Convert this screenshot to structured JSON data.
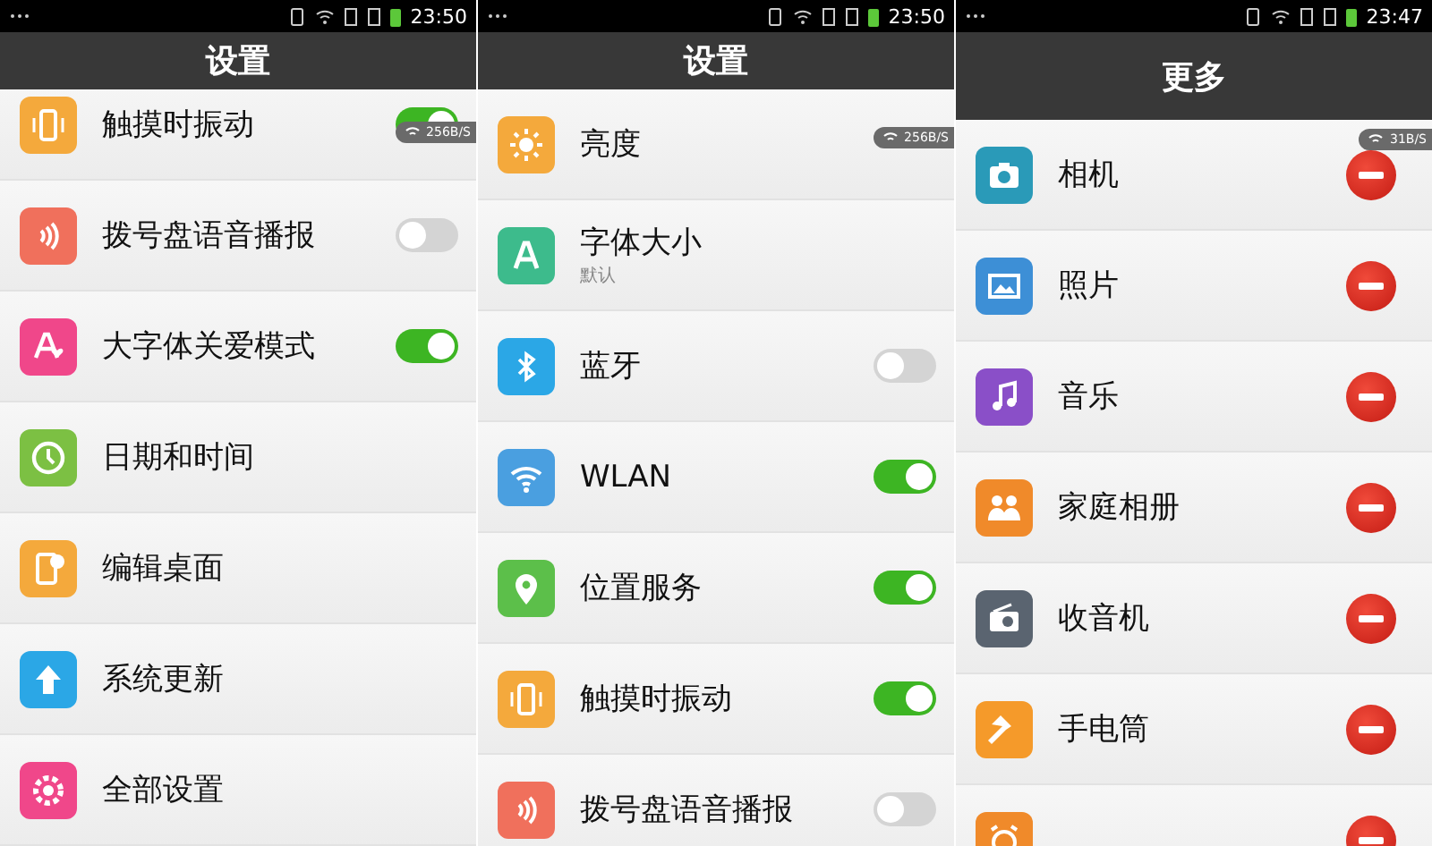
{
  "panels": [
    {
      "status_bar": {
        "time": "23:50"
      },
      "title": "设置",
      "badge": "256B/S",
      "items": [
        {
          "label": "触摸时振动",
          "kind": "toggle",
          "on": true,
          "color": "#f4a93c"
        },
        {
          "label": "拨号盘语音播报",
          "kind": "toggle",
          "on": false,
          "color": "#f0705c"
        },
        {
          "label": "大字体关爱模式",
          "kind": "toggle",
          "on": true,
          "color": "#f0478a"
        },
        {
          "label": "日期和时间",
          "kind": "link",
          "color": "#7cc043"
        },
        {
          "label": "编辑桌面",
          "kind": "link",
          "color": "#f4a93c"
        },
        {
          "label": "系统更新",
          "kind": "link",
          "color": "#2ba7e6"
        },
        {
          "label": "全部设置",
          "kind": "link",
          "color": "#f0478a"
        }
      ]
    },
    {
      "status_bar": {
        "time": "23:50"
      },
      "title": "设置",
      "badge": "256B/S",
      "items": [
        {
          "label": "亮度",
          "kind": "link",
          "color": "#f4a93c"
        },
        {
          "label": "字体大小",
          "subtitle": "默认",
          "kind": "link",
          "color": "#3dbb8c"
        },
        {
          "label": "蓝牙",
          "kind": "toggle",
          "on": false,
          "color": "#2ba7e6"
        },
        {
          "label": "WLAN",
          "kind": "toggle",
          "on": true,
          "color": "#4a9fe0"
        },
        {
          "label": "位置服务",
          "kind": "toggle",
          "on": true,
          "color": "#5cbf4a"
        },
        {
          "label": "触摸时振动",
          "kind": "toggle",
          "on": true,
          "color": "#f4a93c"
        },
        {
          "label": "拨号盘语音播报",
          "kind": "toggle",
          "on": false,
          "color": "#f0705c"
        }
      ]
    },
    {
      "status_bar": {
        "time": "23:47"
      },
      "title": "更多",
      "badge": "31B/S",
      "items": [
        {
          "label": "相机",
          "kind": "remove",
          "color": "#2a9ab8"
        },
        {
          "label": "照片",
          "kind": "remove",
          "color": "#3d8fd6"
        },
        {
          "label": "音乐",
          "kind": "remove",
          "color": "#8a4fc8"
        },
        {
          "label": "家庭相册",
          "kind": "remove",
          "color": "#f08a2a"
        },
        {
          "label": "收音机",
          "kind": "remove",
          "color": "#5a6470"
        },
        {
          "label": "手电筒",
          "kind": "remove",
          "color": "#f59a2a"
        },
        {
          "kind": "remove",
          "color": "#f08a2a"
        }
      ]
    }
  ]
}
